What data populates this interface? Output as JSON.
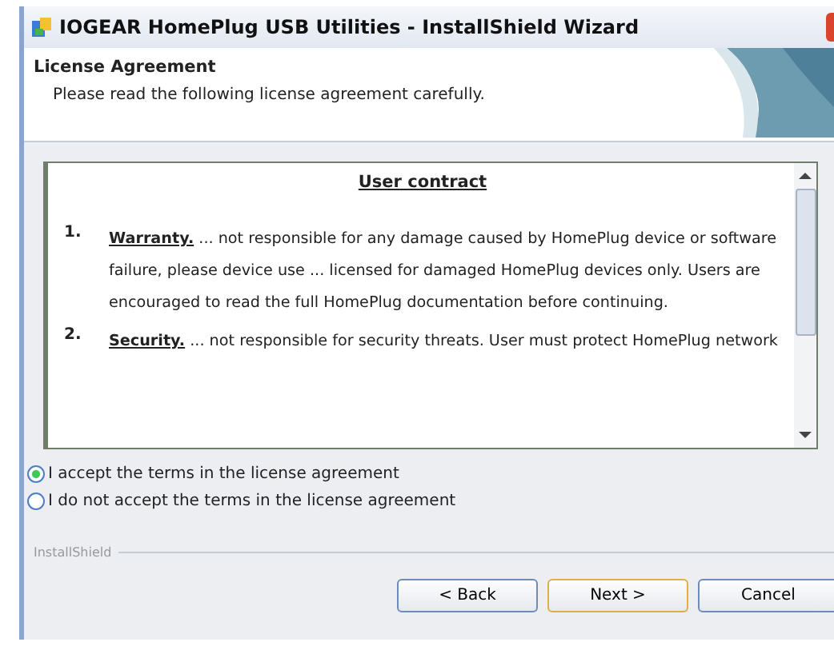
{
  "window": {
    "title": "IOGEAR HomePlug USB Utilities - InstallShield Wizard"
  },
  "header": {
    "title": "License Agreement",
    "subtitle": "Please read the following license agreement carefully."
  },
  "document": {
    "heading": "User contract",
    "items": [
      {
        "number": "1.",
        "heading": "Warranty.",
        "text": " ... not responsible for any damage caused by HomePlug device or software failure, please device use ... licensed for damaged HomePlug devices only. Users are encouraged to read the full HomePlug documentation before continuing."
      },
      {
        "number": "2.",
        "heading": "Security.",
        "text": " ... not responsible for security threats. User must protect HomePlug network"
      }
    ]
  },
  "options": [
    {
      "label": "I accept the terms in the license agreement",
      "selected": true
    },
    {
      "label": "I do not accept the terms in the license agreement",
      "selected": false
    }
  ],
  "brand": "InstallShield",
  "buttons": [
    {
      "label": "< Back",
      "default": false
    },
    {
      "label": "Next >",
      "default": true
    },
    {
      "label": "Cancel",
      "default": false
    }
  ]
}
